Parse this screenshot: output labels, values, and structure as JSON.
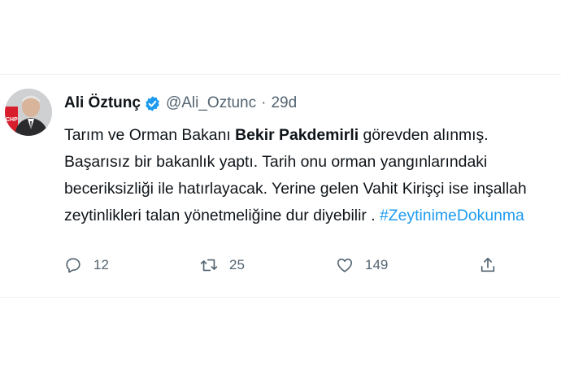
{
  "tweet": {
    "author_name": "Ali Öztunç",
    "handle": "@Ali_Oztunc",
    "separator": "·",
    "time": "29d",
    "text_before": "Tarım ve Orman Bakanı ",
    "text_bold": "Bekir Pakdemirli",
    "text_after": " görevden alınmış. Başarısız bir bakanlık yaptı. Tarih onu orman yangınlarındaki beceriksizliği ile hatırlayacak. Yerine gelen Vahit Kirişçi ise inşallah zeytinlikleri talan yönetmeliğine dur diyebilir . ",
    "hashtag": "#ZeytinimeDokunma",
    "avatar_badge": "CHP"
  },
  "actions": {
    "reply_count": "12",
    "retweet_count": "25",
    "like_count": "149"
  },
  "icons": [
    "verified-badge-icon",
    "reply-icon",
    "retweet-icon",
    "like-icon",
    "share-icon"
  ],
  "colors": {
    "accent": "#1d9bf0",
    "secondary_text": "#536471",
    "primary_text": "#0f1419"
  }
}
